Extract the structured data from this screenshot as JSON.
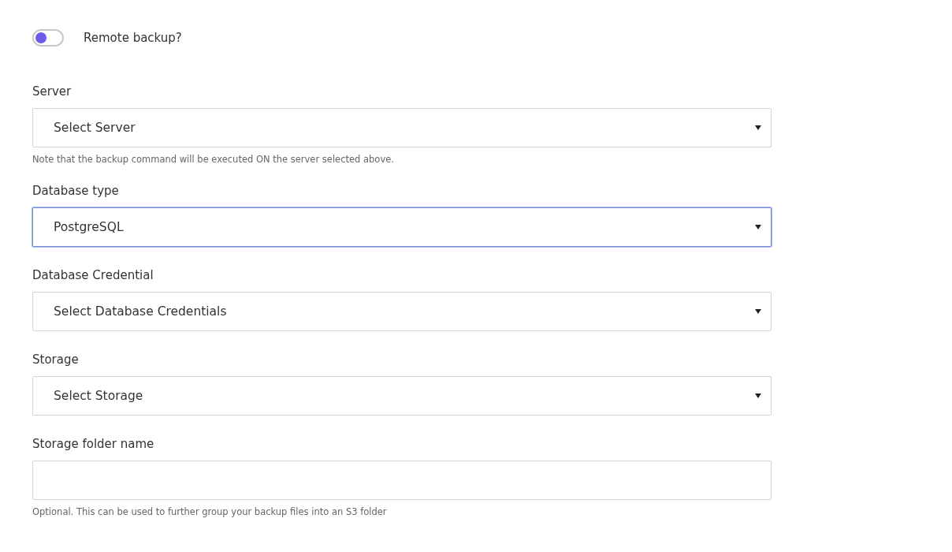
{
  "remote_backup": {
    "label": "Remote backup?",
    "checked": false
  },
  "fields": [
    {
      "kind": "select",
      "label": "Server",
      "value": "Select Server",
      "focused": false,
      "help": "Note that the backup command will be executed ON the server selected above."
    },
    {
      "kind": "select",
      "label": "Database type",
      "value": "PostgreSQL",
      "focused": true
    },
    {
      "kind": "select",
      "label": "Database Credential",
      "value": "Select Database Credentials",
      "focused": false
    },
    {
      "kind": "select",
      "label": "Storage",
      "value": "Select Storage",
      "focused": false
    },
    {
      "kind": "text",
      "label": "Storage folder name",
      "focused": false,
      "help": "Optional. This can be used to further group your backup files into an S3 folder"
    }
  ]
}
